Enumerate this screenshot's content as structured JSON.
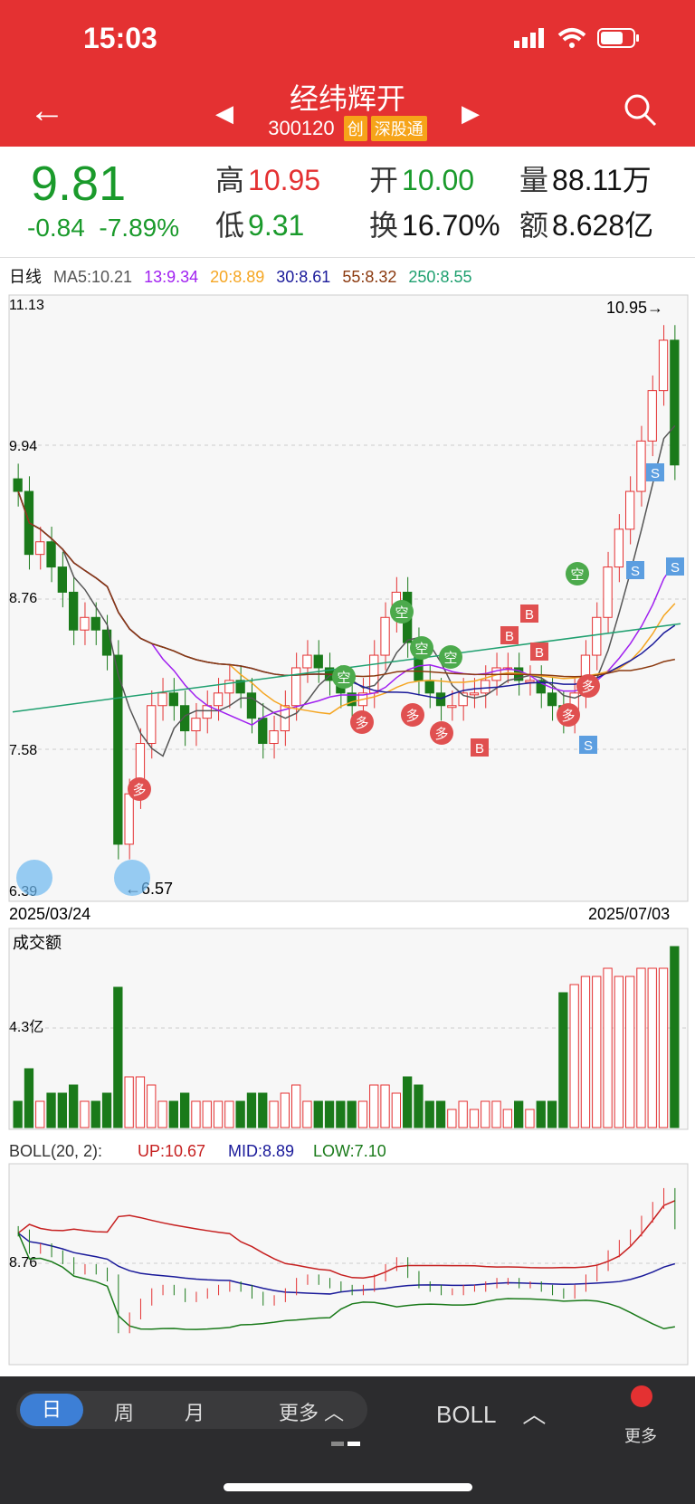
{
  "status": {
    "time": "15:03"
  },
  "header": {
    "title": "经纬辉开",
    "code": "300120",
    "tag1": "创",
    "tag2": "深股通"
  },
  "quote": {
    "price": "9.81",
    "change": "-0.84",
    "change_pct": "-7.89%",
    "high_label": "高",
    "high": "10.95",
    "low_label": "低",
    "low": "9.31",
    "open_label": "开",
    "open": "10.00",
    "turnover_label": "换",
    "turnover": "16.70%",
    "volume_label": "量",
    "volume": "88.11万",
    "amount_label": "额",
    "amount": "8.628亿"
  },
  "ma": {
    "period": "日线",
    "ma5": "MA5:10.21",
    "ma13": "13:9.34",
    "ma20": "20:8.89",
    "ma30": "30:8.61",
    "ma55": "55:8.32",
    "ma250": "250:8.55"
  },
  "colors": {
    "up": "#e43132",
    "down": "#1a7a1a",
    "ma5": "#555555",
    "ma13": "#a020f0",
    "ma20": "#f5a623",
    "ma30": "#1a1a9a",
    "ma55": "#8b3a10",
    "ma250": "#20a070"
  },
  "main_chart": {
    "ylabels": [
      "11.13",
      "9.94",
      "8.76",
      "7.58",
      "6.39"
    ],
    "high_mark": "10.95→",
    "low_mark": "←6.57",
    "start_date": "2025/03/24",
    "end_date": "2025/07/03",
    "signals": {
      "duo": "多",
      "kong": "空",
      "buy": "B",
      "sell": "S"
    }
  },
  "volume_chart": {
    "title": "成交额",
    "ylabel": "4.3亿"
  },
  "boll": {
    "title": "BOLL(20, 2):",
    "up": "UP:10.67",
    "mid": "MID:8.89",
    "low": "LOW:7.10",
    "ylabel": "8.76"
  },
  "chart_data": {
    "type": "candlestick",
    "ylim": [
      6.39,
      11.13
    ],
    "closes": [
      9.6,
      9.1,
      9.2,
      9.0,
      8.8,
      8.5,
      8.6,
      8.5,
      8.3,
      6.8,
      7.2,
      7.6,
      7.9,
      8.0,
      7.9,
      7.7,
      7.8,
      7.9,
      8.0,
      8.1,
      8.0,
      7.8,
      7.6,
      7.7,
      7.9,
      8.2,
      8.3,
      8.2,
      8.1,
      8.0,
      7.9,
      8.0,
      8.3,
      8.6,
      8.8,
      8.4,
      8.1,
      8.0,
      7.9,
      7.9,
      8.0,
      8.0,
      8.1,
      8.2,
      8.2,
      8.1,
      8.1,
      8.0,
      7.9,
      7.8,
      8.0,
      8.3,
      8.6,
      9.0,
      9.3,
      9.6,
      10.0,
      10.4,
      10.8,
      9.81
    ]
  },
  "bottom": {
    "tabs": [
      "日",
      "周",
      "月",
      "更多"
    ],
    "indicator": "BOLL",
    "more": "更多"
  }
}
